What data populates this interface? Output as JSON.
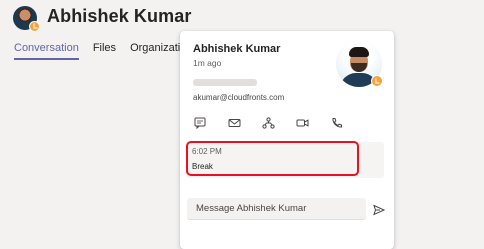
{
  "header": {
    "name": "Abhishek Kumar",
    "presence": "away"
  },
  "tabs": [
    {
      "label": "Conversation",
      "active": true
    },
    {
      "label": "Files",
      "active": false
    },
    {
      "label": "Organization",
      "active": false
    }
  ],
  "card": {
    "name": "Abhishek Kumar",
    "local_time": "1m ago",
    "email": "akumar@cloudfronts.com",
    "actions": [
      "chat-icon",
      "mail-icon",
      "org-chart-icon",
      "video-call-icon",
      "phone-icon"
    ],
    "status_note": {
      "time": "6:02 PM",
      "text": "Break"
    },
    "message_placeholder": "Message Abhishek Kumar"
  },
  "colors": {
    "accent": "#6264a7",
    "away": "#f8a23b",
    "highlight": "#e81123"
  }
}
